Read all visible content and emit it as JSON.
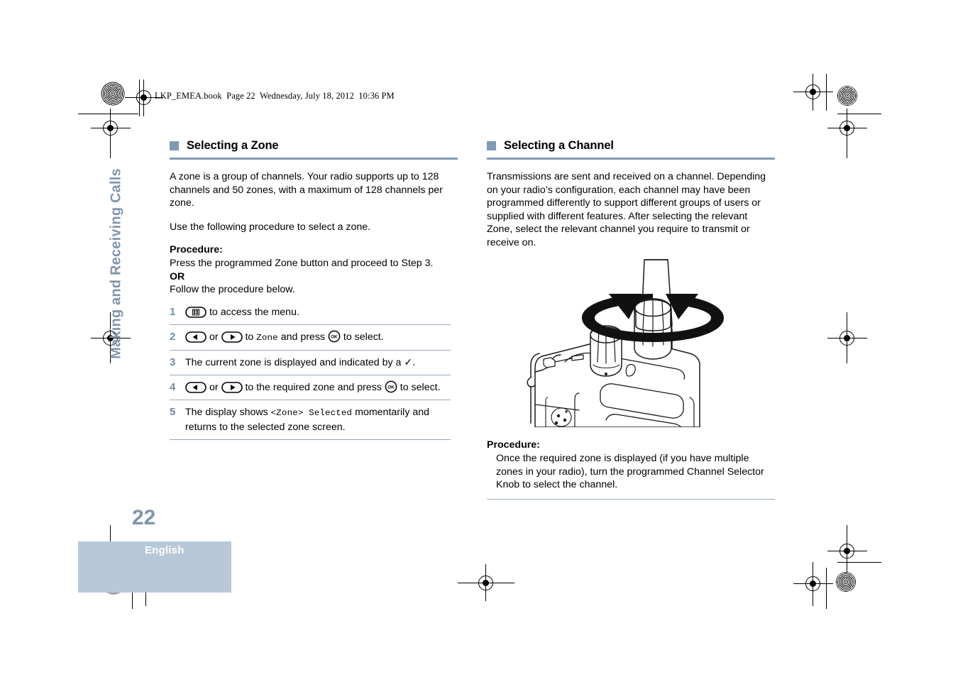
{
  "header": {
    "book_line": "LKP_EMEA.book  Page 22  Wednesday, July 18, 2012  10:36 PM"
  },
  "sidebar": {
    "chapter_tab": "Making and Receiving Calls",
    "page_number": "22",
    "language": "English",
    "tab_color": "#b8c8d8",
    "accent_color": "#8295ad"
  },
  "theme": {
    "accent": "#7f9ab5",
    "rule": "#9aaabb",
    "step_number_color": "#6f8ba6"
  },
  "left_column": {
    "heading": "Selecting a Zone",
    "paragraphs": [
      "A zone is a group of channels. Your radio supports up to 128 channels and 50 zones, with a maximum of 128 channels per zone.",
      "Use the following procedure to select a zone."
    ],
    "procedure_label": "Procedure:",
    "procedure_lines": [
      "Press the programmed Zone button and proceed to Step 3.",
      "OR",
      "Follow the procedure below."
    ],
    "steps": [
      {
        "num": "1",
        "icon_before": "menu-button-icon",
        "text_after": " to access the menu."
      },
      {
        "num": "2",
        "text_parts": {
          "mid_or": " or ",
          "to": " to ",
          "code": "Zone",
          "and_press": " and press ",
          "tail": " to select."
        }
      },
      {
        "num": "3",
        "text": "The current zone is displayed and indicated by a ✓."
      },
      {
        "num": "4",
        "text_parts": {
          "mid_or": " or ",
          "to": " to the required zone and press ",
          "tail": " to select."
        }
      },
      {
        "num": "5",
        "text_parts": {
          "lead": "The display shows ",
          "code": "<Zone> Selected",
          "tail": " momentarily and returns to the selected zone screen."
        }
      }
    ]
  },
  "right_column": {
    "heading": "Selecting a Channel",
    "paragraph": "Transmissions are sent and received on a channel. Depending on your radio’s configuration, each channel may have been programmed differently to support different groups of users or supplied with different features. After selecting the relevant Zone, select the relevant channel you require to transmit or receive on.",
    "illustration_name": "radio-channel-selector-knob-rotation-diagram",
    "procedure_label": "Procedure:",
    "procedure_text": "Once the required zone is displayed (if you have multiple zones in your radio), turn the programmed Channel Selector Knob to select the channel."
  },
  "icons": {
    "menu_button": "menu-button-icon",
    "left_arrow_button": "left-arrow-button-icon",
    "right_arrow_button": "right-arrow-button-icon",
    "ok_button": "ok-button-icon",
    "ok_label": "OK",
    "checkmark": "✓"
  }
}
